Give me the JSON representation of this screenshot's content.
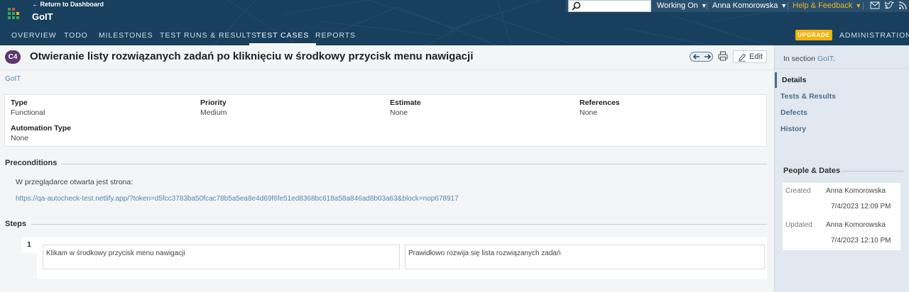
{
  "header": {
    "return_link": "← Return to Dashboard",
    "project_name": "GoIT",
    "working_on": "Working On",
    "user": "Anna Komorowska",
    "help": "Help & Feedback",
    "upgrade": "UPGRADE",
    "administration": "ADMINISTRATION",
    "tabs": [
      "OVERVIEW",
      "TODO",
      "MILESTONES",
      "TEST RUNS & RESULTS",
      "TEST CASES",
      "REPORTS"
    ],
    "active_tab": "TEST CASES"
  },
  "case": {
    "id": "C4",
    "title": "Otwieranie listy rozwiązanych zadań po kliknięciu w środkowy przycisk menu nawigacji",
    "edit_label": "Edit",
    "section_link": "GoIT"
  },
  "fields": {
    "type_label": "Type",
    "type_value": "Functional",
    "priority_label": "Priority",
    "priority_value": "Medium",
    "estimate_label": "Estimate",
    "estimate_value": "None",
    "references_label": "References",
    "references_value": "None",
    "automation_label": "Automation Type",
    "automation_value": "None"
  },
  "preconditions": {
    "heading": "Preconditions",
    "text": "W przeglądarce otwarta jest strona:",
    "url": "https://qa-autocheck-test.netlify.app/?token=d5fcc3783ba50fcac78b5a5ea8e4d69f6fe51ed8368bc618a58a846ad8b03a63&block=nop678917"
  },
  "steps": {
    "heading": "Steps",
    "items": [
      {
        "number": "1",
        "content": "Klikam w środkowy przycisk menu nawigacji",
        "expected": "Prawidłowo rozwija się lista rozwiązanych zadań"
      }
    ]
  },
  "sidebar": {
    "section_prefix": "In section",
    "section_name": "GoIT",
    "section_suffix": ".",
    "items": [
      "Details",
      "Tests & Results",
      "Defects",
      "History"
    ],
    "people_heading": "People & Dates",
    "created_label": "Created",
    "created_by": "Anna Komorowska",
    "created_at": "7/4/2023 12:09 PM",
    "updated_label": "Updated",
    "updated_by": "Anna Komorowska",
    "updated_at": "7/4/2023 12:10 PM"
  },
  "colors": {
    "header_bg": "#18405e",
    "accent_link": "#5a86ad",
    "case_badge": "#5d3770",
    "upgrade": "#f5b30e",
    "help": "#f0b423"
  }
}
